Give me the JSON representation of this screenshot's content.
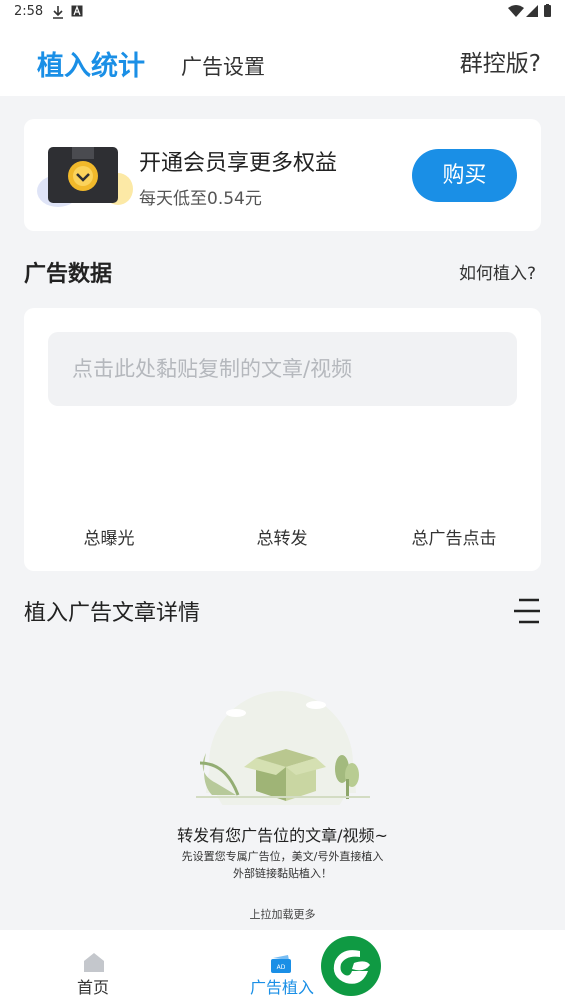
{
  "status_bar": {
    "time": "2:58"
  },
  "header": {
    "tabs": [
      {
        "label": "植入统计"
      },
      {
        "label": "广告设置"
      }
    ],
    "group_link": "群控版?"
  },
  "vip_banner": {
    "title": "开通会员享更多权益",
    "subtitle": "每天低至0.54元",
    "buy_label": "购买"
  },
  "ad_data": {
    "title": "广告数据",
    "help_link": "如何植入?",
    "paste_placeholder": "点击此处黏贴复制的文章/视频",
    "stats": [
      {
        "label": "总曝光"
      },
      {
        "label": "总转发"
      },
      {
        "label": "总广告点击"
      }
    ]
  },
  "details": {
    "title": "植入广告文章详情",
    "empty_title": "转发有您广告位的文章/视频~",
    "empty_line1": "先设置您专属广告位，美文/号外直接植入",
    "empty_line2": "外部链接黏贴植入！",
    "load_more": "上拉加载更多"
  },
  "bottom_nav": {
    "items": [
      {
        "label": "首页",
        "icon": "home-icon"
      },
      {
        "label": "广告植入",
        "icon": "ad-icon"
      }
    ]
  },
  "colors": {
    "accent": "#1a8fe6",
    "brand_green": "#0f9a43"
  }
}
